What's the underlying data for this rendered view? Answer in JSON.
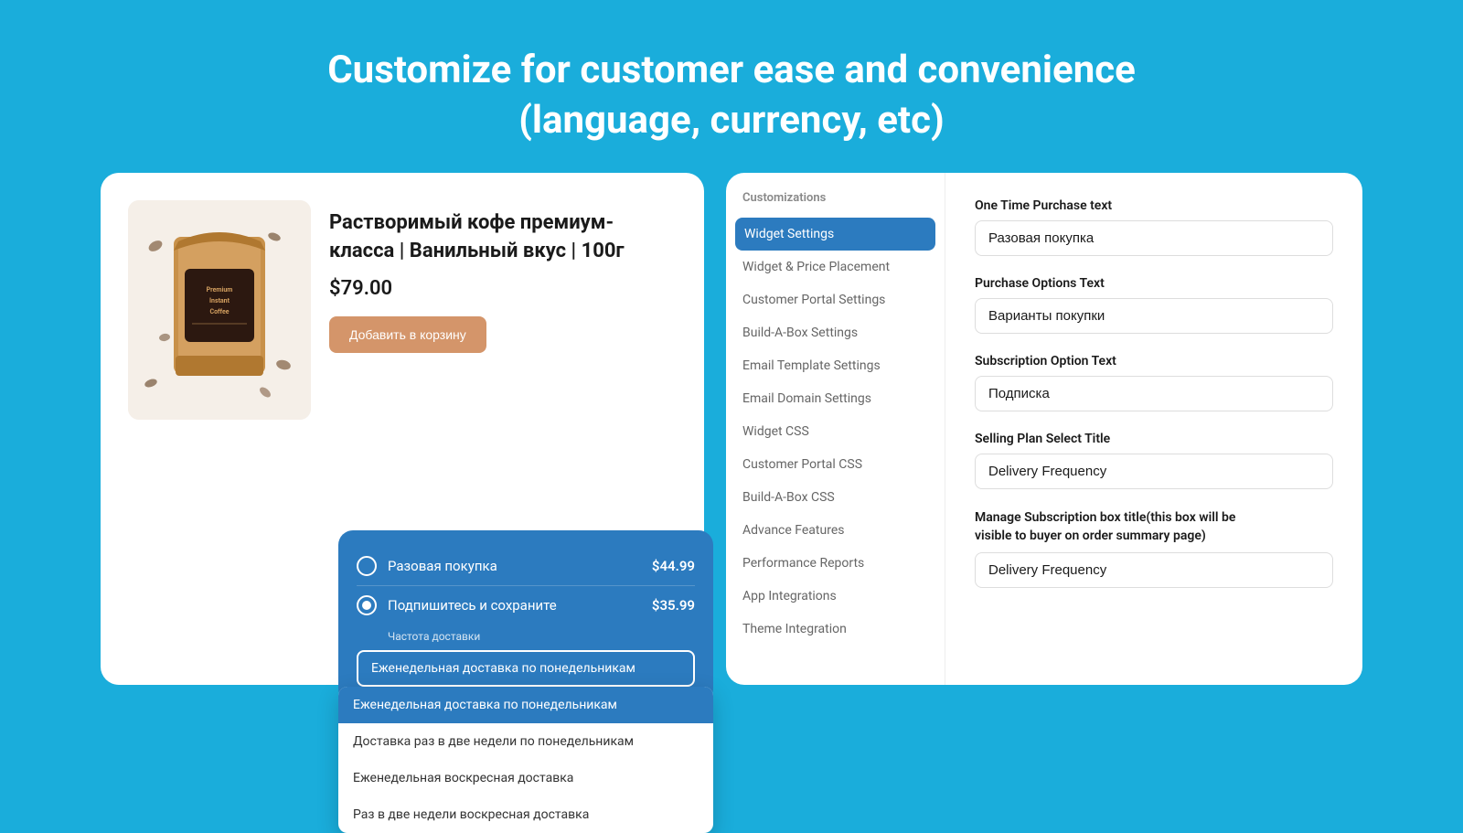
{
  "header": {
    "line1": "Customize for customer ease and convenience",
    "line2": "(language, currency, etc)"
  },
  "leftCard": {
    "product": {
      "title": "Растворимый кофе премиум-класса | Ванильный вкус | 100г",
      "price": "$79.00",
      "addToCart": "Добавить в корзину"
    },
    "widget": {
      "option1": {
        "label": "Разовая покупка",
        "price": "$44.99"
      },
      "option2": {
        "label": "Подпишитесь и сохраните",
        "price": "$35.99"
      },
      "frequencyLabel": "Частота доставки",
      "selectedFrequency": "Еженедельная доставка по понедельникам"
    },
    "dropdown": {
      "items": [
        {
          "label": "Еженедельная доставка по понедельникам",
          "selected": true
        },
        {
          "label": "Доставка раз в две недели по понедельникам",
          "selected": false
        },
        {
          "label": "Еженедельная воскресная доставка",
          "selected": false
        },
        {
          "label": "Раз в две недели воскресная доставка",
          "selected": false
        }
      ]
    }
  },
  "rightCard": {
    "sidebar": {
      "title": "Customizations",
      "items": [
        {
          "label": "Widget Settings",
          "active": true
        },
        {
          "label": "Widget & Price Placement",
          "active": false
        },
        {
          "label": "Customer Portal Settings",
          "active": false
        },
        {
          "label": "Build-A-Box Settings",
          "active": false
        },
        {
          "label": "Email Template Settings",
          "active": false
        },
        {
          "label": "Email Domain Settings",
          "active": false
        },
        {
          "label": "Widget CSS",
          "active": false
        },
        {
          "label": "Customer Portal CSS",
          "active": false
        },
        {
          "label": "Build-A-Box CSS",
          "active": false
        },
        {
          "label": "Advance Features",
          "active": false
        },
        {
          "label": "Performance Reports",
          "active": false
        },
        {
          "label": "App Integrations",
          "active": false
        },
        {
          "label": "Theme Integration",
          "active": false
        }
      ]
    },
    "settings": {
      "fields": [
        {
          "label": "One Time Purchase text",
          "value": "Разовая покупка"
        },
        {
          "label": "Purchase Options Text",
          "value": "Варианты покупки"
        },
        {
          "label": "Subscription Option Text",
          "value": "Подписка"
        },
        {
          "label": "Selling Plan Select Title",
          "value": "Delivery Frequency"
        },
        {
          "label": "Manage Subscription box title(this box will be visible to buyer on order summary page)",
          "value": "Delivery Frequency",
          "multiline": true
        }
      ]
    }
  }
}
